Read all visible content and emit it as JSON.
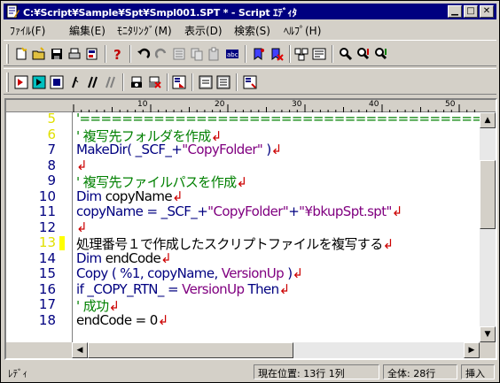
{
  "window": {
    "title": "C:¥Script¥Sample¥Spt¥Smpl001.SPT * - Script ｴﾃﾞｨﾀ"
  },
  "menu": {
    "items": [
      "ﾌｧｲﾙ(F)",
      "編集(E)",
      "ﾓﾆﾀﾘﾝｸﾞ(M)",
      "表示(D)",
      "検索(S)",
      "ﾍﾙﾌﾟ(H)"
    ]
  },
  "ruler": {
    "ticks": [
      "10",
      "20",
      "30",
      "40",
      "50"
    ]
  },
  "editor": {
    "lines": [
      {
        "num": "5",
        "segs": [
          {
            "t": "'================================================",
            "c": "grn"
          },
          {
            "t": "↲",
            "c": "red"
          }
        ],
        "dim": true
      },
      {
        "num": "6",
        "segs": [
          {
            "t": "' 複写先フォルダを作成",
            "c": "grn"
          },
          {
            "t": "↲",
            "c": "red"
          }
        ],
        "dim": true
      },
      {
        "num": "7",
        "segs": [
          {
            "t": "MakeDir( _SCF_+",
            "c": "blu"
          },
          {
            "t": "\"CopyFolder\"",
            "c": "pur"
          },
          {
            "t": " )",
            "c": "blu"
          },
          {
            "t": "↲",
            "c": "red"
          }
        ]
      },
      {
        "num": "8",
        "segs": [
          {
            "t": "↲",
            "c": "red"
          }
        ]
      },
      {
        "num": "9",
        "segs": [
          {
            "t": "' 複写先ファイルパスを作成",
            "c": "grn"
          },
          {
            "t": "↲",
            "c": "red"
          }
        ]
      },
      {
        "num": "10",
        "segs": [
          {
            "t": "Dim ",
            "c": "blu"
          },
          {
            "t": "copyName",
            "c": "blk"
          },
          {
            "t": "↲",
            "c": "red"
          }
        ]
      },
      {
        "num": "11",
        "segs": [
          {
            "t": "copyName = _SCF_+",
            "c": "blu"
          },
          {
            "t": "\"CopyFolder\"",
            "c": "pur"
          },
          {
            "t": "+",
            "c": "blu"
          },
          {
            "t": "\"¥bkupSpt.spt\"",
            "c": "pur"
          },
          {
            "t": "↲",
            "c": "red"
          }
        ]
      },
      {
        "num": "12",
        "segs": [
          {
            "t": "↲",
            "c": "red"
          }
        ]
      },
      {
        "num": "13",
        "segs": [
          {
            "t": " 処理番号１で作成したスクリプトファイルを複写する",
            "c": "blk"
          },
          {
            "t": "↲",
            "c": "red"
          }
        ],
        "current": true
      },
      {
        "num": "14",
        "segs": [
          {
            "t": "Dim ",
            "c": "blu"
          },
          {
            "t": "endCode",
            "c": "blk"
          },
          {
            "t": "↲",
            "c": "red"
          }
        ]
      },
      {
        "num": "15",
        "segs": [
          {
            "t": "Copy ( %1, copyName, ",
            "c": "blu"
          },
          {
            "t": "VersionUp",
            "c": "pur"
          },
          {
            "t": " )",
            "c": "blu"
          },
          {
            "t": "↲",
            "c": "red"
          }
        ]
      },
      {
        "num": "16",
        "segs": [
          {
            "t": "if _COPY_RTN_ = ",
            "c": "blu"
          },
          {
            "t": "VersionUp",
            "c": "pur"
          },
          {
            "t": " Then",
            "c": "blu"
          },
          {
            "t": "↲",
            "c": "red"
          }
        ]
      },
      {
        "num": "17",
        "segs": [
          {
            "t": "    ' 成功",
            "c": "grn"
          },
          {
            "t": "↲",
            "c": "red"
          }
        ]
      },
      {
        "num": "18",
        "segs": [
          {
            "t": "    endCode = 0",
            "c": "blk"
          },
          {
            "t": "↲",
            "c": "red"
          }
        ]
      }
    ]
  },
  "status": {
    "ready": "ﾚﾃﾞｨ",
    "position_label": "現在位置:",
    "line": "13行",
    "col": "1列",
    "total_label": "全体:",
    "total": "28行",
    "mode": "挿入"
  }
}
